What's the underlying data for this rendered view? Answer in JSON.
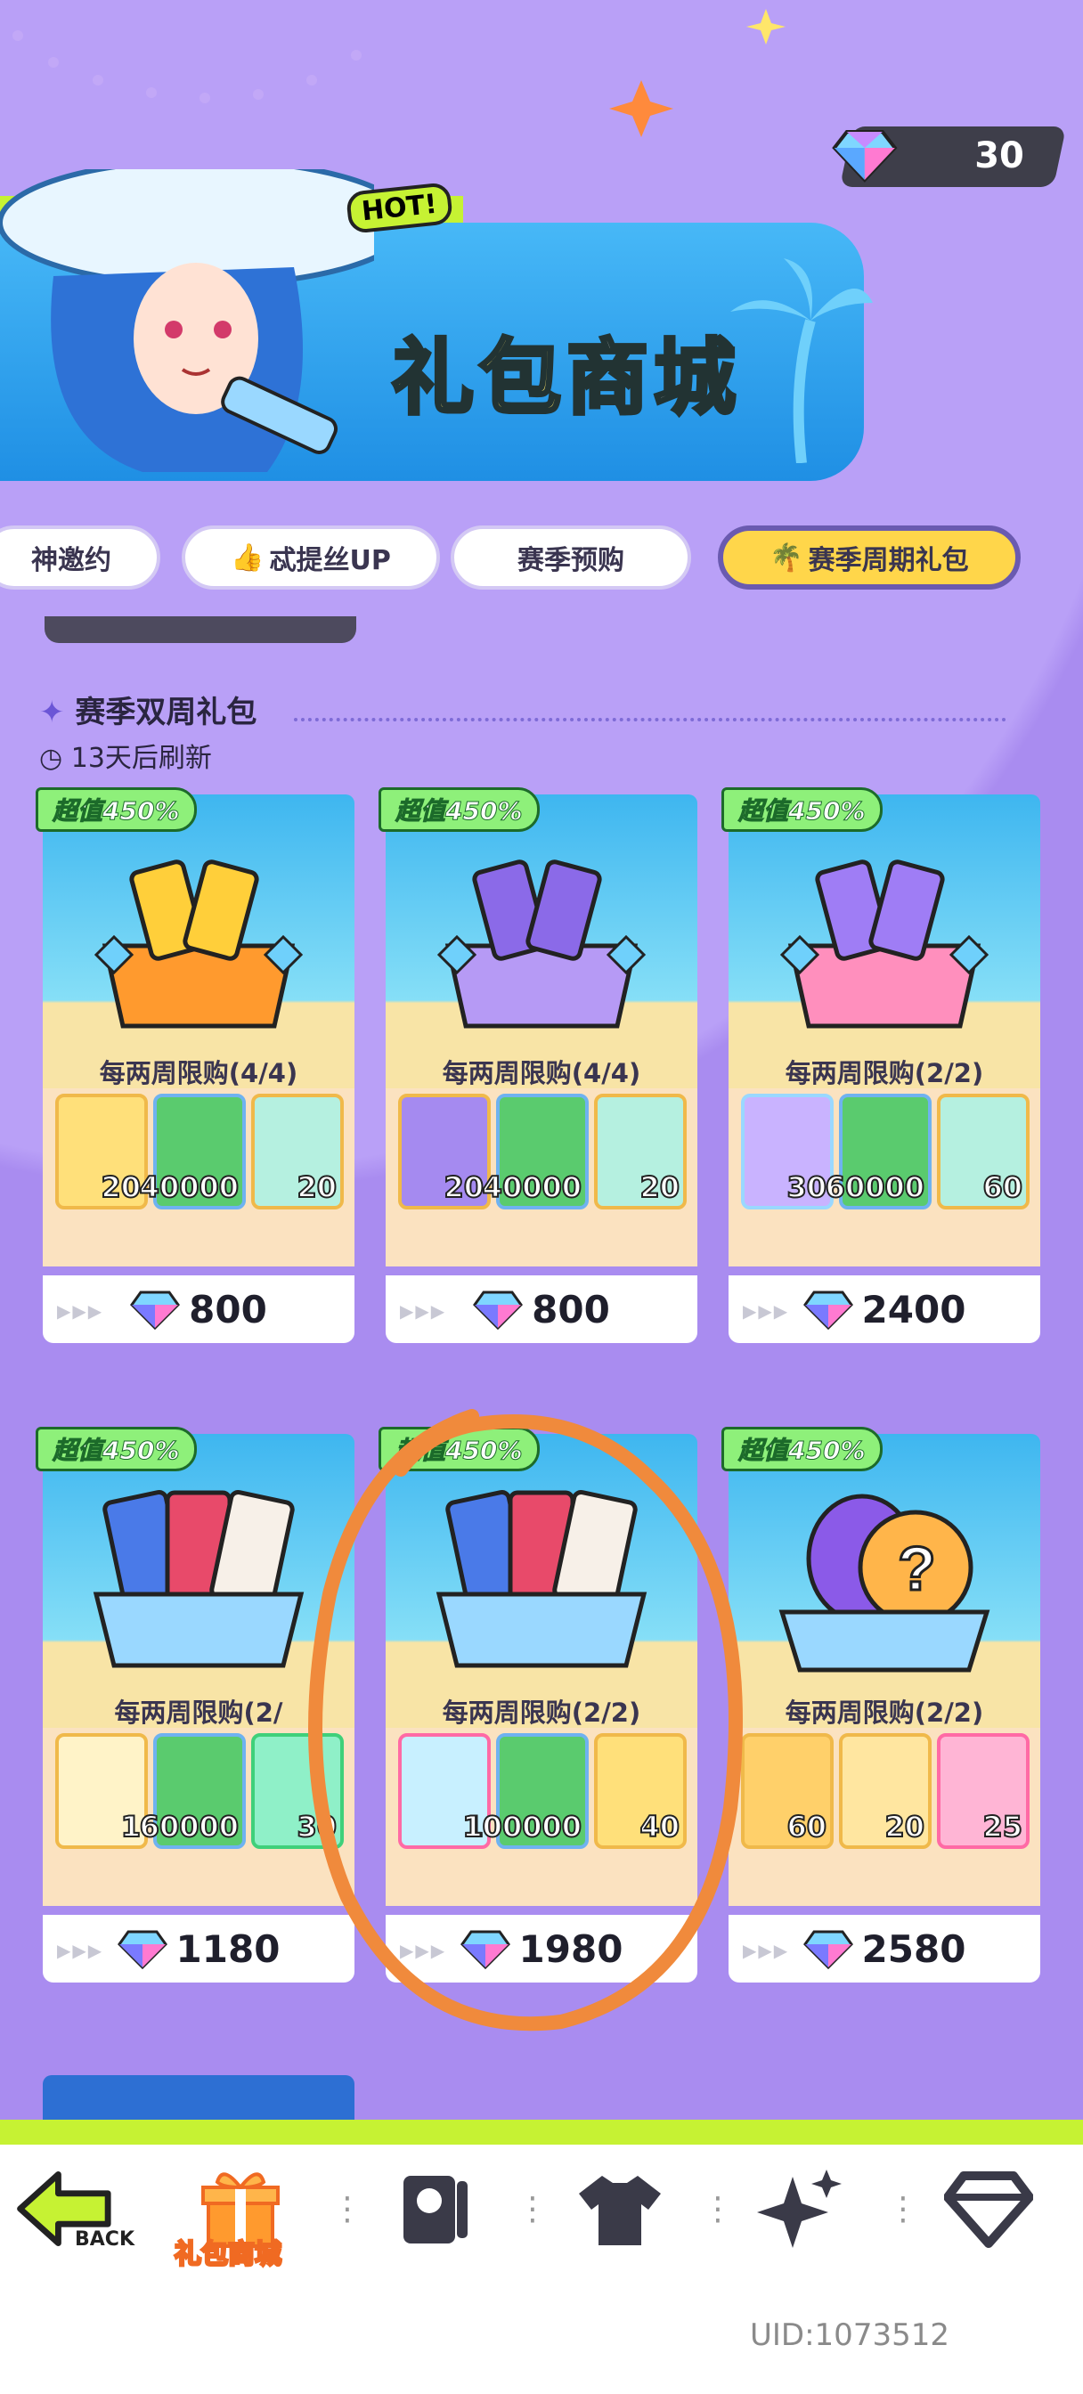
{
  "currency": {
    "icon": "diamond-icon",
    "amount": "30"
  },
  "banner": {
    "hot_label": "HOT!",
    "title_part1": "礼包",
    "title_part2": "商城"
  },
  "tabs": [
    {
      "label": "神邀约",
      "active": false
    },
    {
      "label": "忒提丝UP",
      "active": false,
      "icon": "thumbs-up-icon"
    },
    {
      "label": "赛季预购",
      "active": false
    },
    {
      "label": "赛季周期礼包",
      "active": true,
      "icon": "palm-tree-icon"
    }
  ],
  "section": {
    "title": "赛季双周礼包",
    "refresh": "13天后刷新"
  },
  "cards": [
    {
      "badge": "超值450%",
      "limit": "每两周限购(4/4)",
      "price": "800",
      "items": [
        {
          "icon": "gold-ticket-icon",
          "count": "20"
        },
        {
          "icon": "cash-icon",
          "count": "40000"
        },
        {
          "icon": "jar-icon",
          "count": "20"
        }
      ]
    },
    {
      "badge": "超值450%",
      "limit": "每两周限购(4/4)",
      "price": "800",
      "items": [
        {
          "icon": "purple-ticket-icon",
          "count": "20"
        },
        {
          "icon": "cash-icon",
          "count": "40000"
        },
        {
          "icon": "jar-icon",
          "count": "20"
        }
      ]
    },
    {
      "badge": "超值450%",
      "limit": "每两周限购(2/2)",
      "price": "2400",
      "items": [
        {
          "icon": "holo-ticket-icon",
          "count": "30"
        },
        {
          "icon": "cash-icon",
          "count": "60000"
        },
        {
          "icon": "jar-icon",
          "count": "60"
        }
      ]
    },
    {
      "badge": "超值450%",
      "limit": "每两周限购(2/",
      "price": "1180",
      "items": [
        {
          "icon": "star-card-icon",
          "count": "1"
        },
        {
          "icon": "cash-icon",
          "count": "60000"
        },
        {
          "icon": "shell-icon",
          "count": "30"
        }
      ]
    },
    {
      "badge": "超值450%",
      "limit": "每两周限购(2/2)",
      "price": "1980",
      "items": [
        {
          "icon": "pink-star-card-icon",
          "count": "1"
        },
        {
          "icon": "cash-icon",
          "count": "100000"
        },
        {
          "icon": "coin-icon",
          "count": "40"
        }
      ]
    },
    {
      "badge": "超值450%",
      "limit": "每两周限购(2/2)",
      "price": "2580",
      "items": [
        {
          "icon": "mystery-egg-icon",
          "count": "60"
        },
        {
          "icon": "cool-can-icon",
          "count": "20"
        },
        {
          "icon": "pink-can-icon",
          "count": "25"
        }
      ]
    }
  ],
  "nav": {
    "back": "BACK",
    "gift_shop": "礼包商城",
    "items": [
      "back-icon",
      "gift-icon",
      "card-icon",
      "shirt-icon",
      "sparkle-icon",
      "diamond-icon"
    ]
  },
  "uid": "UID:1073512",
  "colors": {
    "accent": "#c6f233",
    "background": "#a98cf0",
    "annotation": "#f08a3c"
  }
}
